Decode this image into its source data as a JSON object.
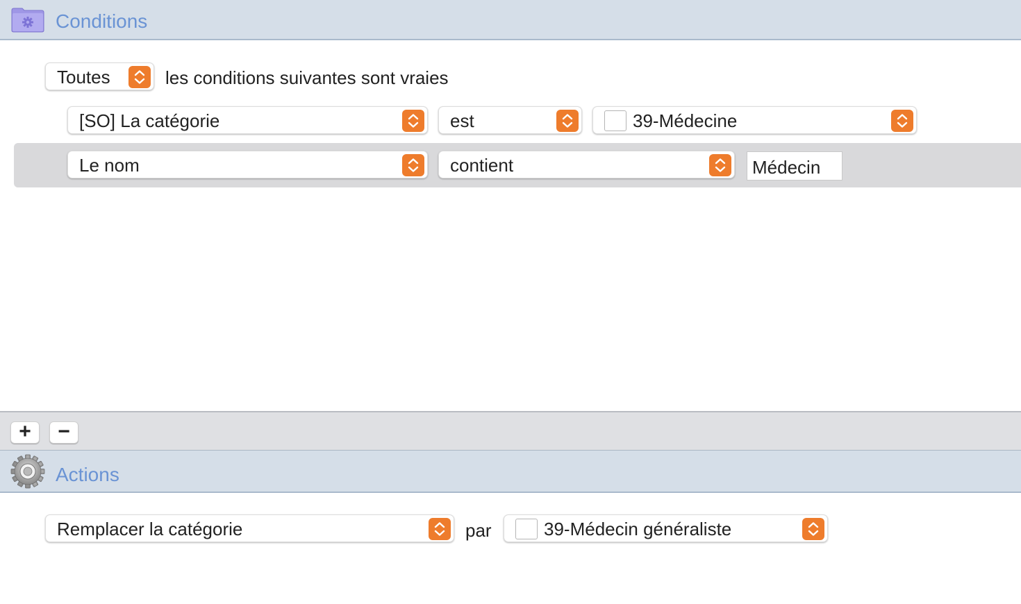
{
  "conditions": {
    "title": "Conditions",
    "match_select": "Toutes",
    "match_suffix": "les conditions suivantes sont vraies",
    "rows": [
      {
        "field": "[SO] La catégorie",
        "operator": "est",
        "value": "39-Médecine"
      },
      {
        "field": "Le nom",
        "operator": "contient",
        "value": "Médecin"
      }
    ]
  },
  "buttons": {
    "add": "+",
    "remove": "−"
  },
  "actions": {
    "title": "Actions",
    "action": "Remplacer la catégorie",
    "connector": "par",
    "value": "39-Médecin généraliste"
  },
  "colors": {
    "accent": "#ee7c2c",
    "header_bg": "#d5dee8",
    "header_text": "#6a93d4",
    "selected_row": "#d9d9db"
  }
}
